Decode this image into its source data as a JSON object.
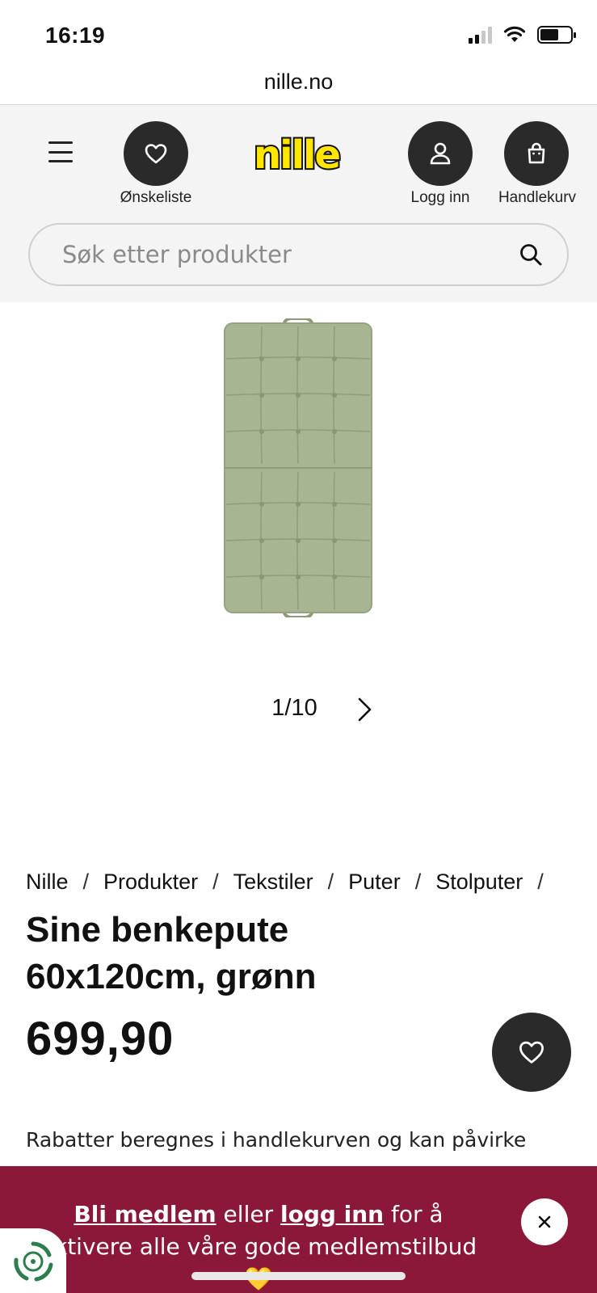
{
  "status_bar": {
    "time": "16:19"
  },
  "browser": {
    "url": "nille.no"
  },
  "header": {
    "wishlist_label": "Ønskeliste",
    "login_label": "Logg inn",
    "cart_label": "Handlekurv",
    "logo_text": "nille",
    "search_placeholder": "Søk etter produkter"
  },
  "gallery": {
    "current": "1/10"
  },
  "breadcrumb": [
    "Nille",
    "Produkter",
    "Tekstiler",
    "Puter",
    "Stolputer"
  ],
  "product": {
    "title": "Sine benkepute 60x120cm, grønn",
    "price": "699,90",
    "discount_note": "Rabatter beregnes i handlekurven og kan påvirke"
  },
  "banner": {
    "join_link": "Bli medlem",
    "or_text": " eller ",
    "login_link": "logg inn",
    "rest_text": " for å aktivere alle våre gode medlemstilbud 💛"
  },
  "colors": {
    "banner_bg": "#8b1838",
    "logo_yellow": "#ffe600",
    "product_green": "#a8b592",
    "dark_button": "#2a2a2a"
  }
}
